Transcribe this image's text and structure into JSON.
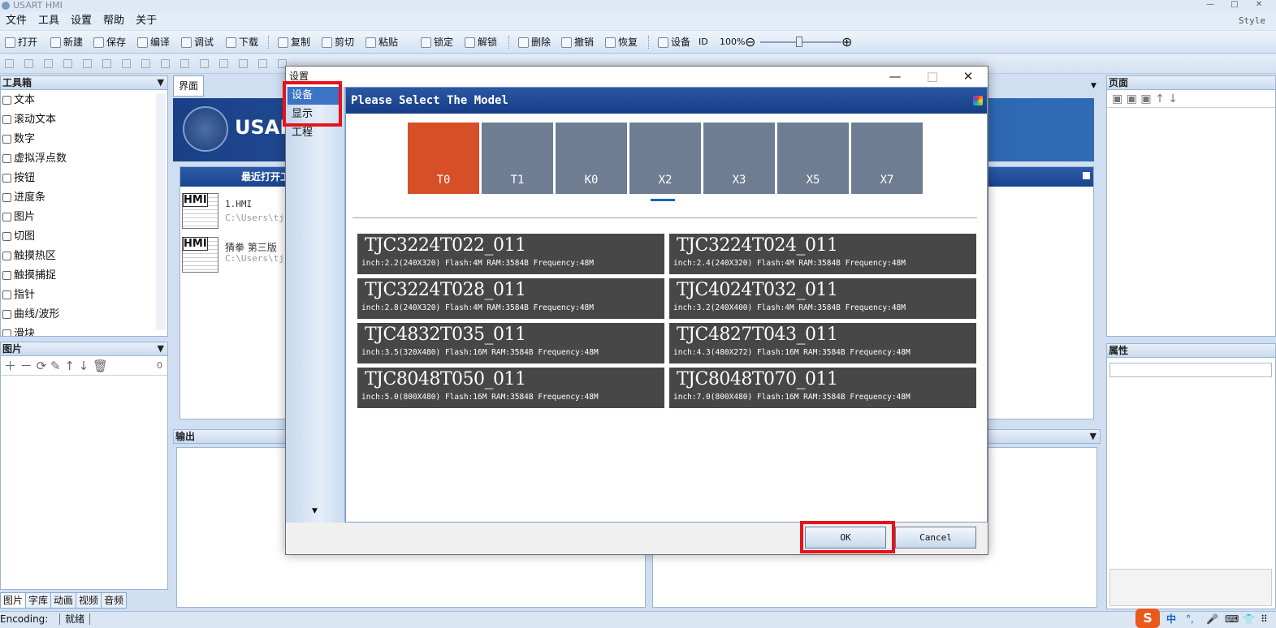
{
  "app": {
    "title": "USART HMI",
    "style_label": "Style",
    "win_min": "—",
    "win_max": "□",
    "win_close": "✕"
  },
  "menu": [
    "文件",
    "工具",
    "设置",
    "帮助",
    "关于"
  ],
  "toolbar": {
    "items": [
      "打开",
      "新建",
      "保存",
      "编译",
      "调试",
      "下载",
      "复制",
      "剪切",
      "粘贴",
      "锁定",
      "解锁",
      "删除",
      "撤销",
      "恢复",
      "设备",
      "ID",
      "100%"
    ],
    "zoom_minus": "⊖",
    "zoom_plus": "⊕"
  },
  "toolbox": {
    "title": "工具箱",
    "items": [
      "文本",
      "滚动文本",
      "数字",
      "虚拟浮点数",
      "按钮",
      "进度条",
      "图片",
      "切图",
      "触摸热区",
      "触摸捕捉",
      "指针",
      "曲线/波形",
      "滑块"
    ]
  },
  "images_panel": {
    "title": "图片",
    "count": "0",
    "tabs": [
      "图片",
      "字库",
      "动画",
      "视频",
      "音频"
    ]
  },
  "editor": {
    "tab": "界面",
    "banner": "USART",
    "recent_title": "最近打开工程",
    "recent": [
      {
        "name": "1.HMI",
        "path": "C:\\Users\\tj"
      },
      {
        "name": "猜拳 第三版",
        "path": "C:\\Users\\tj"
      }
    ],
    "hmi_icon": "HMI"
  },
  "output_panel": {
    "title": "输出"
  },
  "right": {
    "page_title": "页面",
    "prop_title": "属性"
  },
  "status": {
    "encoding": "Encoding:",
    "state": "就绪"
  },
  "ime": [
    "S",
    "中",
    "°,",
    "🎤",
    "⌨",
    "👕",
    "⠿"
  ],
  "dialog": {
    "title": "设置",
    "nav": [
      "设备",
      "显示",
      "工程"
    ],
    "header": "Please Select The Model",
    "series": [
      "T0",
      "T1",
      "K0",
      "X2",
      "X3",
      "X5",
      "X7"
    ],
    "models": [
      {
        "name": "TJC3224T022_011",
        "spec": "inch:2.2(240X320) Flash:4M RAM:3584B Frequency:48M"
      },
      {
        "name": "TJC3224T024_011",
        "spec": "inch:2.4(240X320) Flash:4M RAM:3584B Frequency:48M"
      },
      {
        "name": "TJC3224T028_011",
        "spec": "inch:2.8(240X320) Flash:4M RAM:3584B Frequency:48M"
      },
      {
        "name": "TJC4024T032_011",
        "spec": "inch:3.2(240X400) Flash:4M RAM:3584B Frequency:48M"
      },
      {
        "name": "TJC4832T035_011",
        "spec": "inch:3.5(320X480) Flash:16M RAM:3584B Frequency:48M"
      },
      {
        "name": "TJC4827T043_011",
        "spec": "inch:4.3(480X272) Flash:16M RAM:3584B Frequency:48M"
      },
      {
        "name": "TJC8048T050_011",
        "spec": "inch:5.0(800X480) Flash:16M RAM:3584B Frequency:48M"
      },
      {
        "name": "TJC8048T070_011",
        "spec": "inch:7.0(800X480) Flash:16M RAM:3584B Frequency:48M"
      }
    ],
    "ok": "OK",
    "cancel": "Cancel",
    "min": "—",
    "max": "□",
    "close": "✕",
    "more": "▼"
  },
  "colors": {
    "accent": "#3d73c5",
    "selected_tile": "#d74f27",
    "tile": "#6e7d92",
    "card": "#474747",
    "highlight": "#e8121a"
  }
}
